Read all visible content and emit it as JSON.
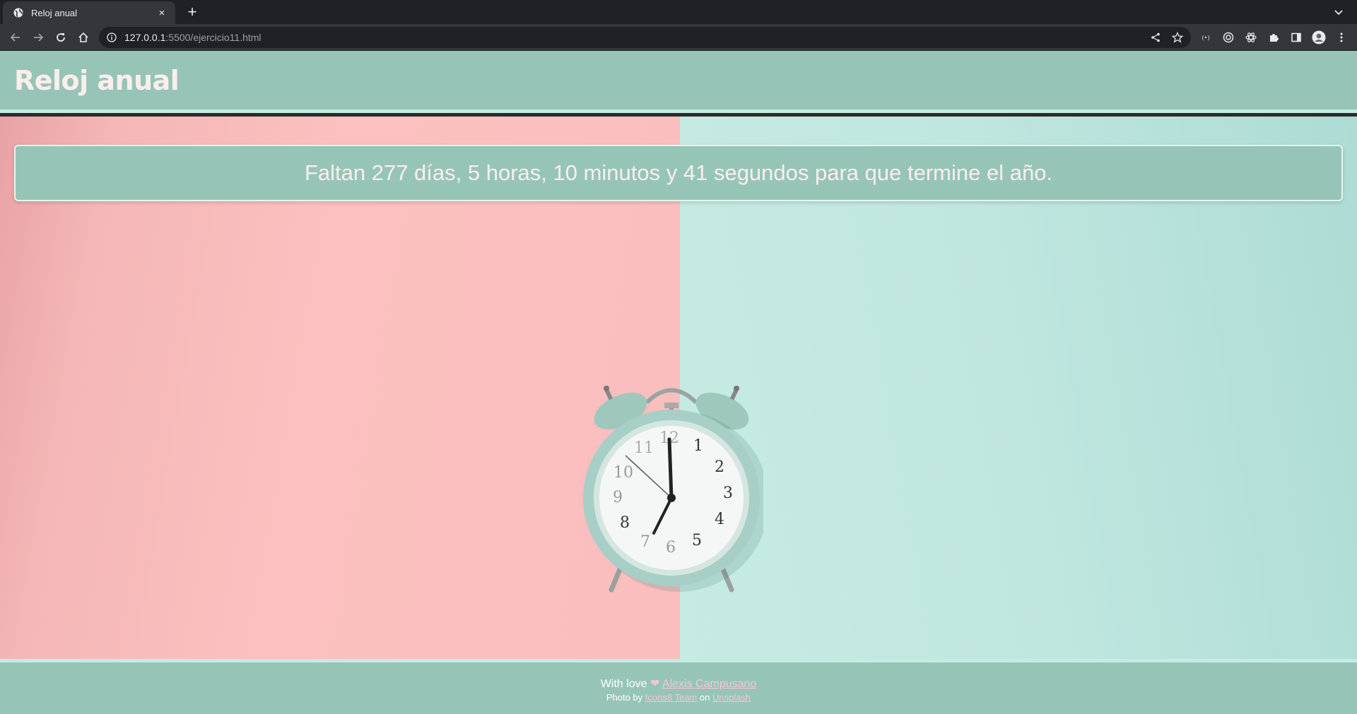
{
  "browser": {
    "tab_title": "Reloj anual",
    "tab_close": "×",
    "new_tab": "+",
    "url_host": "127.0.0.1",
    "url_path": ":5500/ejercicio11.html",
    "icons": [
      "back-icon",
      "forward-icon",
      "reload-icon",
      "home-icon",
      "info-icon",
      "share-icon",
      "star-icon",
      "extension-icon",
      "puzzle-icon",
      "side-panel-icon",
      "profile-icon",
      "menu-icon"
    ]
  },
  "header": {
    "title": "Reloj anual"
  },
  "countdown": {
    "text": "Faltan 277 días, 5 horas, 10 minutos y 41 segundos para que termine el año."
  },
  "footer": {
    "with_love": "With love",
    "heart": "❤",
    "author": "Alexis Campusano",
    "photo_by": "Photo by",
    "photographer": "Icons8 Team",
    "on": "on",
    "source": "Unsplash"
  },
  "colors": {
    "header_bg": "#96c5b8",
    "accent_border": "#c5ece4",
    "pink_bg": "#fbc0bf",
    "mint_bg": "#bfe6df",
    "text_light": "#fbeeee",
    "link": "#f4c6d6"
  }
}
